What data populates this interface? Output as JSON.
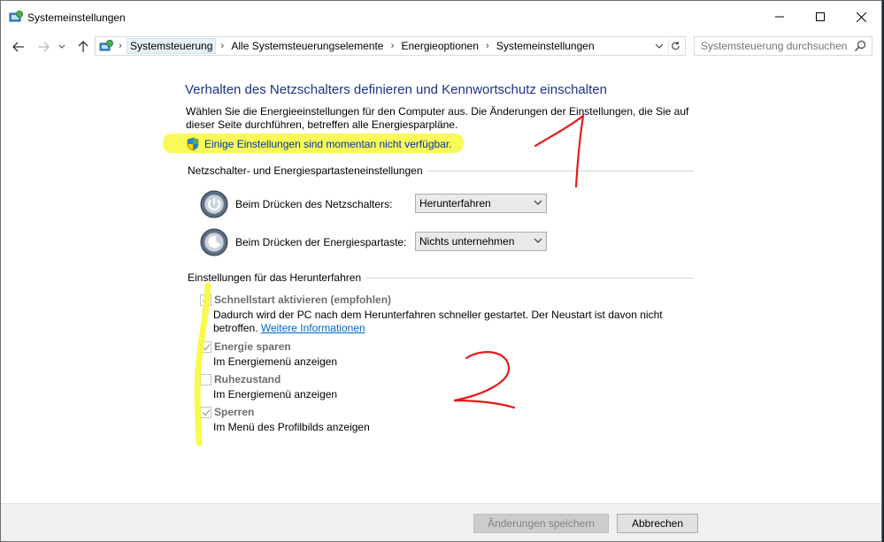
{
  "window": {
    "title": "Systemeinstellungen"
  },
  "address": {
    "crumbs": [
      "Systemsteuerung",
      "Alle Systemsteuerungselemente",
      "Energieoptionen",
      "Systemeinstellungen"
    ],
    "search_placeholder": "Systemsteuerung durchsuchen"
  },
  "page": {
    "heading": "Verhalten des Netzschalters definieren und Kennwortschutz einschalten",
    "intro": "Wählen Sie die Energieeinstellungen für den Computer aus. Die Änderungen der Einstellungen, die Sie auf dieser Seite durchführen, betreffen alle Energiesparpläne.",
    "unavailable": "Einige Einstellungen sind momentan nicht verfügbar."
  },
  "power_section": {
    "title": "Netzschalter- und Energiespartasteneinstellungen",
    "rows": [
      {
        "label": "Beim Drücken des Netzschalters:",
        "value": "Herunterfahren"
      },
      {
        "label": "Beim Drücken der Energiespartaste:",
        "value": "Nichts unternehmen"
      }
    ]
  },
  "shutdown_section": {
    "title": "Einstellungen für das Herunterfahren",
    "items": [
      {
        "label": "Schnellstart aktivieren (empfohlen)",
        "checked": true,
        "desc": "Dadurch wird der PC nach dem Herunterfahren schneller gestartet. Der Neustart ist davon nicht",
        "desc2": "betroffen.",
        "link": "Weitere Informationen"
      },
      {
        "label": "Energie sparen",
        "checked": true,
        "desc": "Im Energiemenü anzeigen"
      },
      {
        "label": "Ruhezustand",
        "checked": false,
        "desc": "Im Energiemenü anzeigen"
      },
      {
        "label": "Sperren",
        "checked": true,
        "desc": "Im Menü des Profilbilds anzeigen"
      }
    ]
  },
  "footer": {
    "save_label": "Änderungen speichern",
    "cancel_label": "Abbrechen"
  },
  "annotations": {
    "mark_1": "1",
    "mark_2": "2",
    "highlight_color": "#f7f93a",
    "ink_color": "#e21b1b"
  }
}
